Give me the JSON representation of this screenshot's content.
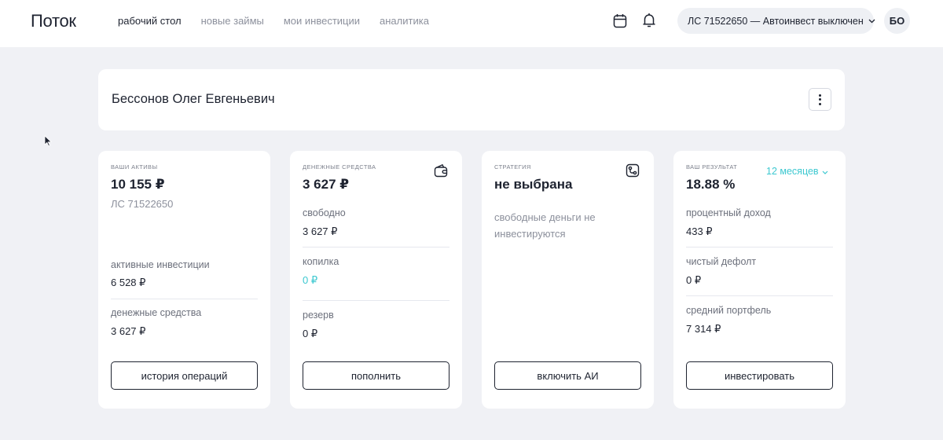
{
  "header": {
    "logo": "Поток",
    "nav": [
      {
        "label": "рабочий стол",
        "active": true
      },
      {
        "label": "новые займы",
        "active": false
      },
      {
        "label": "мои инвестиции",
        "active": false
      },
      {
        "label": "аналитика",
        "active": false
      }
    ],
    "icons": [
      "calendar-icon",
      "bell-icon"
    ],
    "account_label": "ЛС 71522650 — Автоинвест выключен",
    "avatar_initials": "БО"
  },
  "profile": {
    "name": "Бессонов Олег Евгеньевич"
  },
  "cards": {
    "assets": {
      "title": "ваши активы",
      "amount": "10 155 ₽",
      "account": "ЛС 71522650",
      "active_investments_label": "активные инвестиции",
      "active_investments_value": "6 528 ₽",
      "cash_label": "денежные средства",
      "cash_value": "3 627 ₽",
      "button": "история операций"
    },
    "cash": {
      "title": "денежные средства",
      "amount": "3 627 ₽",
      "free_label": "свободно",
      "free_value": "3 627 ₽",
      "piggy_label": "копилка",
      "piggy_value": "0 ₽",
      "reserve_label": "резерв",
      "reserve_value": "0 ₽",
      "button": "пополнить",
      "icon": "wallet-icon"
    },
    "strategy": {
      "title": "стратегия",
      "value": "не выбрана",
      "description": "свободные деньги не инвестируются",
      "button": "включить АИ",
      "icon": "strategy-icon"
    },
    "result": {
      "title": "ваш результат",
      "percent": "18.88 %",
      "period": "12 месяцев",
      "interest_label": "процентный доход",
      "interest_value": "433 ₽",
      "default_label": "чистый дефолт",
      "default_value": "0 ₽",
      "portfolio_label": "средний портфель",
      "portfolio_value": "7 314 ₽",
      "button": "инвестировать"
    }
  },
  "colors": {
    "background": "#f0f1f5",
    "card": "#ffffff",
    "text": "#1e2330",
    "muted": "#8c909c",
    "accent": "#3cc8d0"
  }
}
